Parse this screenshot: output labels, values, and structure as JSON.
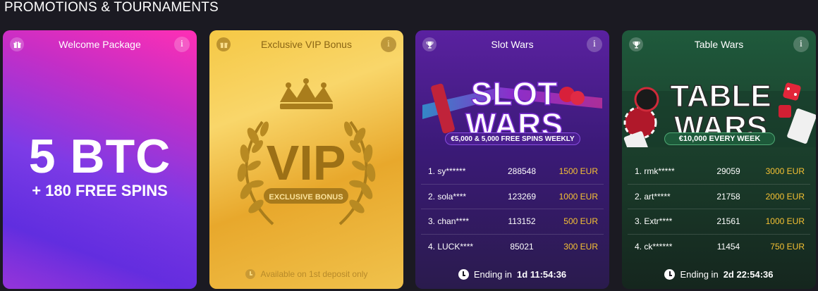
{
  "section_title": "PROMOTIONS & TOURNAMENTS",
  "cards": {
    "welcome": {
      "title": "Welcome Package",
      "headline": "5 BTC",
      "subline": "+ 180 FREE SPINS",
      "icon": "gift-icon",
      "info": "i"
    },
    "vip": {
      "title": "Exclusive VIP Bonus",
      "art_main": "VIP",
      "art_ribbon": "EXCLUSIVE BONUS",
      "footer": "Available on 1st deposit only",
      "icon": "gift-icon",
      "info": "i"
    },
    "slot_wars": {
      "title": "Slot Wars",
      "banner_line1": "SLOT",
      "banner_line2": "WARS",
      "banner_ribbon": "€5,000 & 5,000 FREE SPINS WEEKLY",
      "info": "i",
      "icon": "trophy-icon",
      "leaderboard": [
        {
          "name": "1. sy******",
          "score": "288548",
          "prize": "1500 EUR"
        },
        {
          "name": "2. sola****",
          "score": "123269",
          "prize": "1000 EUR"
        },
        {
          "name": "3. chan****",
          "score": "113152",
          "prize": "500 EUR"
        },
        {
          "name": "4. LUCK****",
          "score": "85021",
          "prize": "300 EUR"
        }
      ],
      "ending_label": "Ending in",
      "ending_value": "1d 11:54:36"
    },
    "table_wars": {
      "title": "Table Wars",
      "banner_line1": "TABLE",
      "banner_line2": "WARS",
      "banner_ribbon": "€10,000 EVERY WEEK",
      "info": "i",
      "icon": "trophy-icon",
      "leaderboard": [
        {
          "name": "1. rmk*****",
          "score": "29059",
          "prize": "3000 EUR"
        },
        {
          "name": "2. art*****",
          "score": "21758",
          "prize": "2000 EUR"
        },
        {
          "name": "3. Extr****",
          "score": "21561",
          "prize": "1000 EUR"
        },
        {
          "name": "4. ck******",
          "score": "11454",
          "prize": "750 EUR"
        }
      ],
      "ending_label": "Ending in",
      "ending_value": "2d 22:54:36"
    }
  },
  "colors": {
    "background": "#1b1a22",
    "prize": "#f7c233",
    "vip_gold": "#f5c845"
  }
}
